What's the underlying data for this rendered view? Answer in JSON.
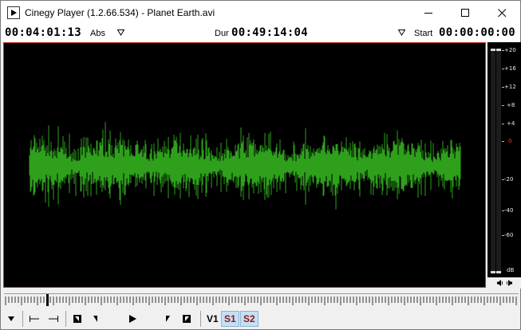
{
  "window": {
    "title": "Cinegy Player (1.2.66.534)  - Planet Earth.avi",
    "icons": {
      "app": "play-icon",
      "minimize": "minimize-icon",
      "maximize": "maximize-icon",
      "close": "close-icon"
    }
  },
  "timebar": {
    "position_tc": "00:04:01:13",
    "position_mode": "Abs",
    "duration_label": "Dur",
    "duration_tc": "00:49:14:04",
    "start_label": "Start",
    "start_tc": "00:00:00:00"
  },
  "meter": {
    "scale": [
      "+20",
      "+16",
      "+12",
      "+8",
      "+4",
      "0",
      "-20",
      "-40",
      "-60",
      "dB"
    ],
    "zero_color": "#ff3b30",
    "channels": 2
  },
  "waveform": {
    "color": "#2ea01c"
  },
  "transport": {
    "channels": [
      {
        "label": "V1",
        "selected": false
      },
      {
        "label": "S1",
        "selected": true
      },
      {
        "label": "S2",
        "selected": true
      }
    ]
  },
  "colors": {
    "accent_red": "#c9302c",
    "selected_bg": "#c6dff2",
    "selected_text": "#8b1a1a"
  }
}
